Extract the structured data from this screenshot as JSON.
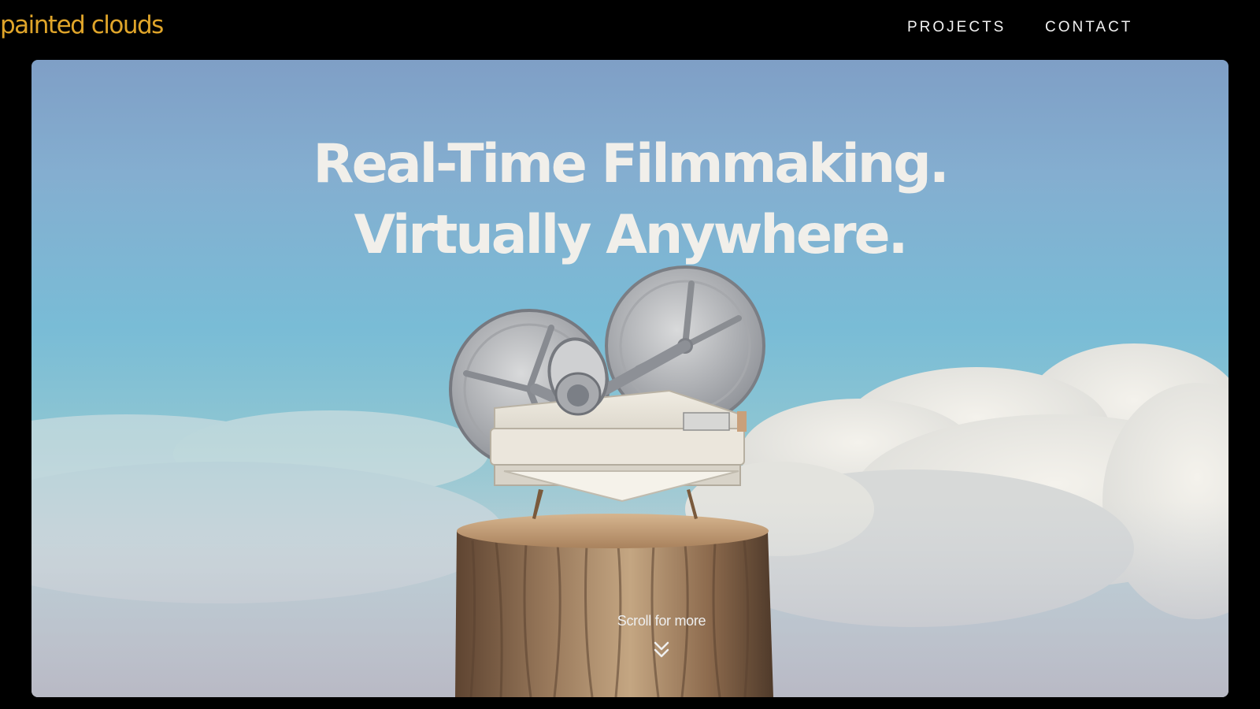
{
  "brand": {
    "logo_text": "painted clouds",
    "accent_color": "#e0a52a"
  },
  "nav": {
    "items": [
      {
        "label": "PROJECTS"
      },
      {
        "label": "CONTACT"
      }
    ]
  },
  "hero": {
    "headline_line1": "Real-Time Filmmaking.",
    "headline_line2": "Virtually Anywhere.",
    "scroll_label": "Scroll for more",
    "scroll_icon": "double-chevron-down-icon",
    "image_subject": "film-projector-on-tree-stump"
  }
}
